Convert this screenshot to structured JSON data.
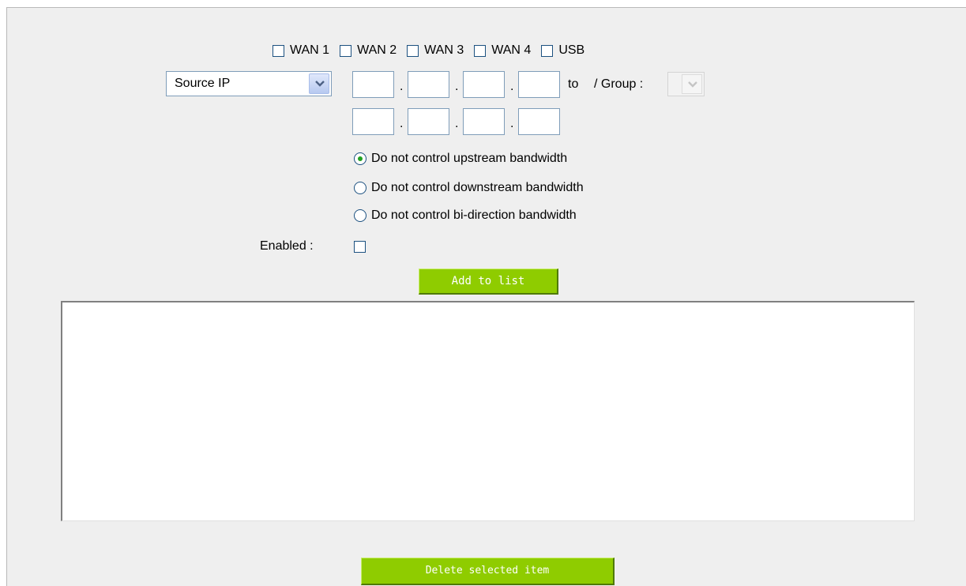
{
  "wan_options": [
    {
      "label": "WAN 1",
      "checked": false
    },
    {
      "label": "WAN 2",
      "checked": false
    },
    {
      "label": "WAN 3",
      "checked": false
    },
    {
      "label": "WAN 4",
      "checked": false
    },
    {
      "label": "USB",
      "checked": false
    }
  ],
  "ip_filter": {
    "type_select_value": "Source IP",
    "start_ip": [
      "",
      "",
      "",
      ""
    ],
    "end_ip": [
      "",
      "",
      "",
      ""
    ],
    "to_label": "to",
    "group_label": "/ Group :",
    "group_select_value": ""
  },
  "bandwidth_options": [
    {
      "label": "Do not control upstream bandwidth",
      "checked": true
    },
    {
      "label": "Do not control downstream bandwidth",
      "checked": false
    },
    {
      "label": "Do not control bi-direction bandwidth",
      "checked": false
    }
  ],
  "enabled": {
    "label": "Enabled :",
    "checked": false
  },
  "add_button_label": "Add to list",
  "list_items": [],
  "delete_button_label": "Delete selected item"
}
